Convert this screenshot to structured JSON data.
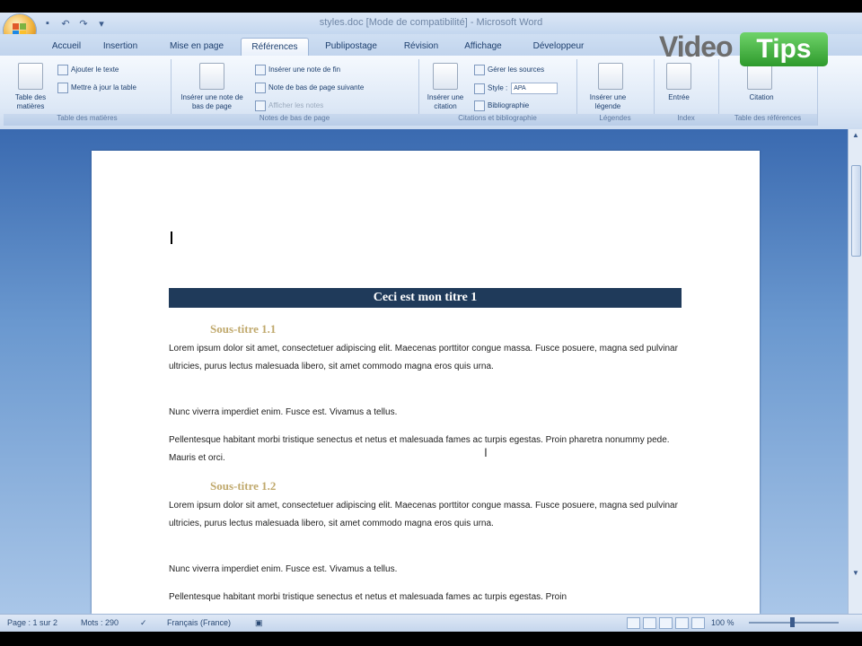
{
  "window": {
    "title": "styles.doc [Mode de compatibilité] - Microsoft Word"
  },
  "quick_access": [
    "save-icon",
    "undo-icon",
    "redo-icon",
    "dropdown-icon"
  ],
  "tabs": [
    {
      "label": "Accueil"
    },
    {
      "label": "Insertion"
    },
    {
      "label": "Mise en page"
    },
    {
      "label": "Références",
      "active": true
    },
    {
      "label": "Publipostage"
    },
    {
      "label": "Révision"
    },
    {
      "label": "Affichage"
    },
    {
      "label": "Développeur"
    }
  ],
  "ribbon": {
    "toc": {
      "table_btn": "Table des matières",
      "add_text": "Ajouter le texte",
      "update_table": "Mettre à jour la table",
      "group_label": "Table des matières"
    },
    "footnotes": {
      "insert_footnote": "Insérer une note de bas de page",
      "insert_endnote": "Insérer une note de fin",
      "next_footnote": "Note de bas de page suivante",
      "show_notes": "Afficher les notes",
      "group_label": "Notes de bas de page"
    },
    "citations": {
      "insert_citation": "Insérer une citation",
      "manage_sources": "Gérer les sources",
      "style_label": "Style :",
      "style_value": "APA",
      "bibliography": "Bibliographie",
      "group_label": "Citations et bibliographie"
    },
    "captions": {
      "insert_caption": "Insérer une légende",
      "group_label": "Légendes"
    },
    "index": {
      "entry": "Entrée",
      "group_label": "Index"
    },
    "authorities": {
      "citation": "Citation",
      "group_label": "Table des références"
    }
  },
  "branding": {
    "video": "Video",
    "tips": "Tips"
  },
  "document": {
    "heading1": "Ceci est mon titre 1",
    "sub1": "Sous-titre 1.1",
    "p1": "Lorem ipsum dolor sit amet, consectetuer adipiscing elit. Maecenas porttitor congue massa. Fusce posuere, magna sed pulvinar ultricies, purus lectus malesuada libero, sit amet commodo magna eros quis urna.",
    "p2": "Nunc viverra imperdiet enim. Fusce est. Vivamus a tellus.",
    "p3": "Pellentesque habitant morbi tristique senectus et netus et malesuada fames ac turpis egestas. Proin pharetra nonummy pede. Mauris et orci.",
    "sub2": "Sous-titre 1.2",
    "p4": "Lorem ipsum dolor sit amet, consectetuer adipiscing elit. Maecenas porttitor congue massa. Fusce posuere, magna sed pulvinar ultricies, purus lectus malesuada libero, sit amet commodo magna eros quis urna.",
    "p5": "Nunc viverra imperdiet enim. Fusce est. Vivamus a tellus.",
    "p6": "Pellentesque habitant morbi tristique senectus et netus et malesuada fames ac turpis egestas. Proin"
  },
  "status": {
    "page": "Page : 1 sur 2",
    "words": "Mots : 290",
    "language": "Français (France)",
    "zoom": "100 %"
  },
  "colors": {
    "heading_bg": "#1f3a5a",
    "subtitle": "#c0a96d",
    "brand_green": "#3aa83a"
  }
}
